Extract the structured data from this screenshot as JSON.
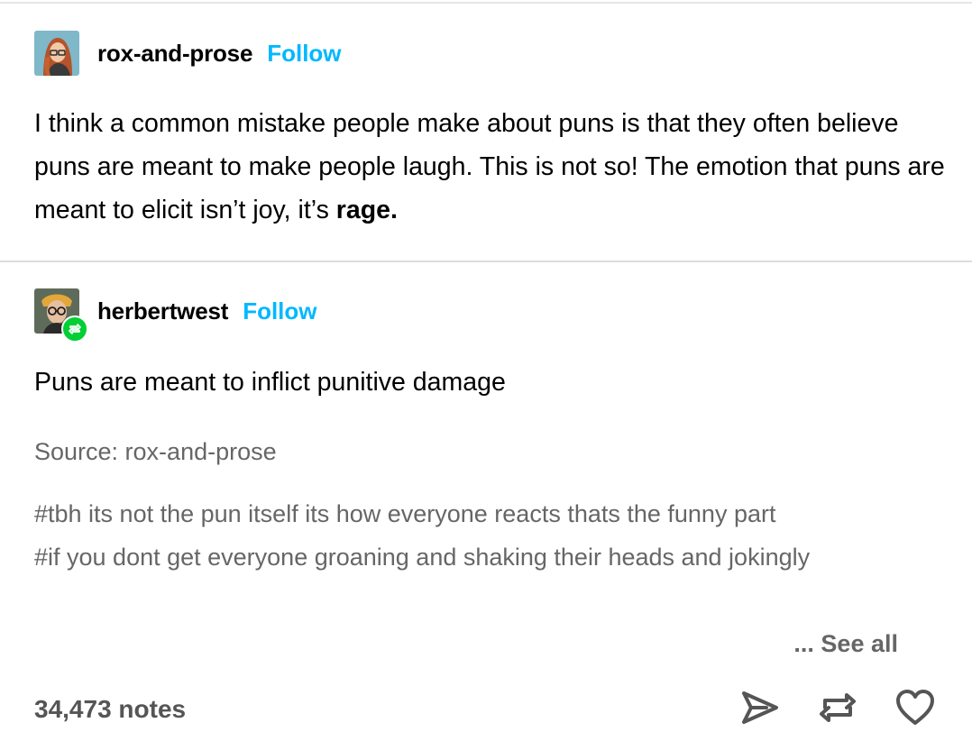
{
  "posts": [
    {
      "username": "rox-and-prose",
      "follow_label": "Follow",
      "avatar_icon": "avatar-redhead-glasses"
    },
    {
      "username": "herbertwest",
      "follow_label": "Follow",
      "avatar_icon": "avatar-man-glasses",
      "reblog_badge_icon": "reblog-icon"
    }
  ],
  "original_post": {
    "text_lead": "I think a common mistake people make about puns is that they often believe puns are meant to make people laugh. This is not so! The emotion that puns are meant to elicit isn’t joy, it’s ",
    "text_bold": "rage."
  },
  "reblog": {
    "text": "Puns are meant to inflict punitive damage",
    "source": "Source: rox-and-prose",
    "tags": [
      "#tbh its not the pun itself its how everyone reacts thats the funny part",
      "#if you dont get everyone groaning and shaking their heads and jokingly"
    ],
    "see_all_label": "... See all"
  },
  "footer": {
    "notes": "34,473 notes",
    "actions": [
      "share-icon",
      "reblog-icon",
      "like-icon"
    ]
  },
  "colors": {
    "follow": "#00b8ff",
    "muted_text": "#666666",
    "reblog_green": "#00cf35"
  }
}
